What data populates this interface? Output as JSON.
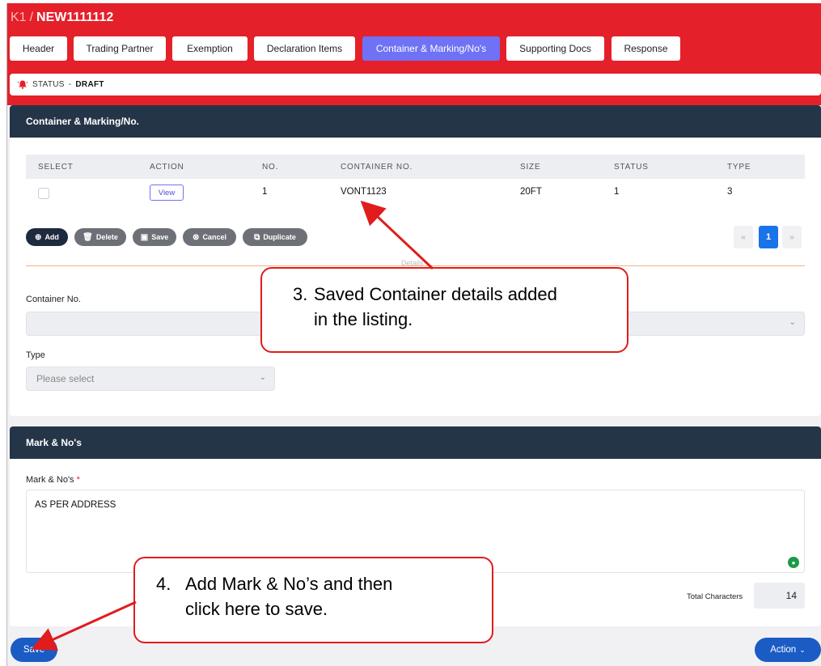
{
  "breadcrumb": {
    "root": "K1",
    "separator": "/",
    "doc": "NEW1111112"
  },
  "tabs": [
    {
      "label": "Header"
    },
    {
      "label": "Trading Partner"
    },
    {
      "label": "Exemption"
    },
    {
      "label": "Declaration Items"
    },
    {
      "label": "Container & Marking/No's"
    },
    {
      "label": "Supporting Docs"
    },
    {
      "label": "Response"
    }
  ],
  "status": {
    "label": "STATUS",
    "dash": "-",
    "value": "DRAFT"
  },
  "container_section": {
    "title": "Container & Marking/No.",
    "columns": [
      "SELECT",
      "ACTION",
      "NO.",
      "CONTAINER NO.",
      "SIZE",
      "STATUS",
      "TYPE"
    ],
    "rows": [
      {
        "action": "View",
        "no": "1",
        "container_no": "VONT1123",
        "size": "20FT",
        "status": "1",
        "type": "3"
      }
    ],
    "buttons": {
      "add": "Add",
      "delete": "Delete",
      "save": "Save",
      "cancel": "Cancel",
      "duplicate": "Duplicate"
    },
    "pager": {
      "prev": "«",
      "current": "1",
      "next": "»"
    },
    "divider_label": "Details",
    "container_no_label": "Container No.",
    "type_label": "Type",
    "type_placeholder": "Please select"
  },
  "mark_section": {
    "title": "Mark & No's",
    "field_label": "Mark & No's",
    "required_mark": "*",
    "value": "AS PER ADDRESS",
    "total_label": "Total Characters",
    "total_value": "14"
  },
  "footer": {
    "save": "Save",
    "action": "Action"
  },
  "callouts": {
    "c3_num": "3.",
    "c3_line1": "Saved Container details added",
    "c3_line2": "in the listing.",
    "c4_num": "4.",
    "c4_line1": "Add Mark & No’s and then",
    "c4_line2": "click here to save."
  },
  "colors": {
    "header_red": "#e4202a",
    "active_tab": "#6f72f5",
    "section_head": "#253548",
    "primary_blue": "#1a5cc4",
    "callout_red": "#e01c1c"
  }
}
